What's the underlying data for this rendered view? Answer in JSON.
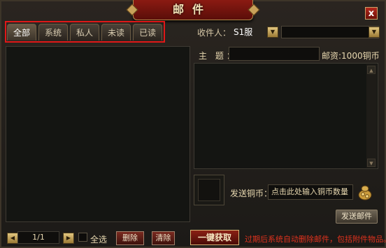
{
  "window": {
    "title": "邮件",
    "close_label": "x"
  },
  "tabs": [
    {
      "label": "全部",
      "active": true
    },
    {
      "label": "系统",
      "active": false
    },
    {
      "label": "私人",
      "active": false
    },
    {
      "label": "未读",
      "active": false
    },
    {
      "label": "已读",
      "active": false
    }
  ],
  "recipient": {
    "label": "收件人：",
    "value": "S1服"
  },
  "compose": {
    "subject_label": "主 题：",
    "postage": "邮资:1000铜币",
    "coin_label": "发送铜币：",
    "coin_placeholder": "点击此处输入铜币数量",
    "send_label": "发送邮件"
  },
  "footer": {
    "page": "1/1",
    "select_all": "全选",
    "delete": "删除",
    "clear": "清除",
    "collect_all": "一键获取",
    "notice": "过期后系统自动删除邮件，包括附件物品。"
  },
  "colors": {
    "highlight": "#e01818",
    "notice": "#e0321e"
  }
}
